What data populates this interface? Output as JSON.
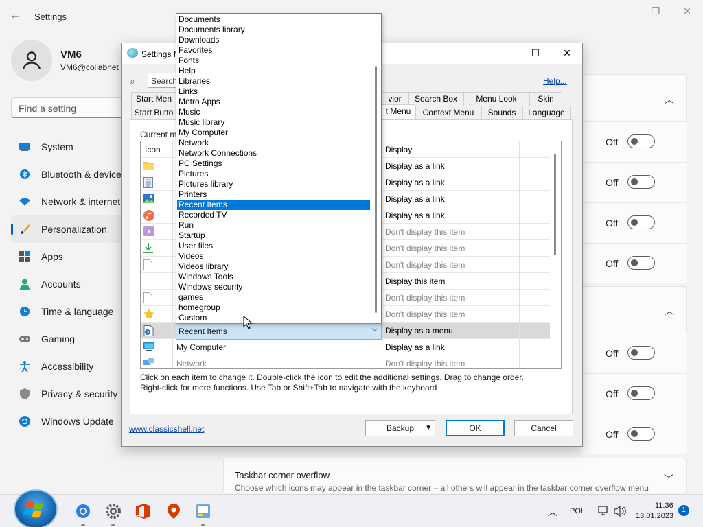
{
  "window": {
    "title": "Settings",
    "minimize": "—",
    "maximize": "❐",
    "close": "✕"
  },
  "user": {
    "name": "VM6",
    "email": "VM6@collabnet"
  },
  "search": {
    "placeholder": "Find a setting"
  },
  "sidebar": {
    "items": [
      {
        "label": "System",
        "icon": "monitor-icon"
      },
      {
        "label": "Bluetooth & devices",
        "icon": "bluetooth-icon"
      },
      {
        "label": "Network & internet",
        "icon": "wifi-icon"
      },
      {
        "label": "Personalization",
        "icon": "brush-icon",
        "active": true
      },
      {
        "label": "Apps",
        "icon": "apps-icon"
      },
      {
        "label": "Accounts",
        "icon": "person-icon"
      },
      {
        "label": "Time & language",
        "icon": "clock-globe-icon"
      },
      {
        "label": "Gaming",
        "icon": "gamepad-icon"
      },
      {
        "label": "Accessibility",
        "icon": "accessibility-icon"
      },
      {
        "label": "Privacy & security",
        "icon": "shield-icon"
      },
      {
        "label": "Windows Update",
        "icon": "update-icon"
      }
    ]
  },
  "toggles": [
    {
      "label": "Off"
    },
    {
      "label": "Off"
    },
    {
      "label": "Off"
    },
    {
      "label": "Off"
    },
    {
      "label": "Off"
    },
    {
      "label": "Off"
    },
    {
      "label": "Off"
    }
  ],
  "overflow": {
    "title": "Taskbar corner overflow",
    "description": "Choose which icons may appear in the taskbar corner – all others will appear in the taskbar corner overflow menu"
  },
  "taskbar": {
    "language": "POL",
    "time": "11:36",
    "date": "13.01.2023",
    "notifications": "1"
  },
  "dialog": {
    "title": "Settings fo",
    "search_text": "Search",
    "help": "Help...",
    "tabs_row1": [
      "Start Men",
      "vior",
      "Search Box",
      "Menu Look",
      "Skin"
    ],
    "tabs_row2": [
      "Start Butto",
      "t Menu",
      "Context Menu",
      "Sounds",
      "Language"
    ],
    "current_label": "Current m",
    "columns": {
      "icon": "Icon",
      "display": "Display"
    },
    "rows": [
      {
        "icon": "folder-icon",
        "name": "",
        "display": "Display as a link",
        "dim": false
      },
      {
        "icon": "document-icon",
        "name": "",
        "display": "Display as a link",
        "dim": false
      },
      {
        "icon": "picture-icon",
        "name": "",
        "display": "Display as a link",
        "dim": false
      },
      {
        "icon": "music-icon",
        "name": "",
        "display": "Display as a link",
        "dim": false
      },
      {
        "icon": "video-icon",
        "name": "",
        "display": "Don't display this item",
        "dim": true
      },
      {
        "icon": "download-icon",
        "name": "",
        "display": "Don't display this item",
        "dim": true
      },
      {
        "icon": "blank-page-icon",
        "name": "",
        "display": "Don't display this item",
        "dim": true
      },
      {
        "icon": "none",
        "name": "",
        "display": "Display this item",
        "dim": false
      },
      {
        "icon": "blank-page-icon",
        "name": "",
        "display": "Don't display this item",
        "dim": true
      },
      {
        "icon": "star-icon",
        "name": "",
        "display": "Don't display this item",
        "dim": true
      },
      {
        "icon": "recent-items-icon",
        "name": "Recent Items",
        "display": "Display as a menu",
        "dim": false,
        "selected": true
      },
      {
        "icon": "computer-icon",
        "name": "My Computer",
        "display": "Display as a link",
        "dim": false
      },
      {
        "icon": "network-icon",
        "name": "Network",
        "display": "Don't display this item",
        "dim": true
      }
    ],
    "combo_value": "Recent Items",
    "hint_line1": "Click on each item to change it. Double-click the icon to edit the additional settings. Drag to change order.",
    "hint_line2": "Right-click for more functions. Use Tab or Shift+Tab to navigate with the keyboard",
    "link": "www.classicshell.net",
    "backup": "Backup",
    "ok": "OK",
    "cancel": "Cancel"
  },
  "dropdown": {
    "items": [
      "Documents",
      "Documents library",
      "Downloads",
      "Favorites",
      "Fonts",
      "Help",
      "Libraries",
      "Links",
      "Metro Apps",
      "Music",
      "Music library",
      "My Computer",
      "Network",
      "Network Connections",
      "PC Settings",
      "Pictures",
      "Pictures library",
      "Printers",
      "Recent Items",
      "Recorded TV",
      "Run",
      "Startup",
      "User files",
      "Videos",
      "Videos library",
      "Windows Tools",
      "Windows security",
      "games",
      "homegroup",
      "Custom"
    ],
    "selected": "Recent Items"
  },
  "colors": {
    "accent": "#0078d7",
    "win_accent": "#005fb8"
  }
}
